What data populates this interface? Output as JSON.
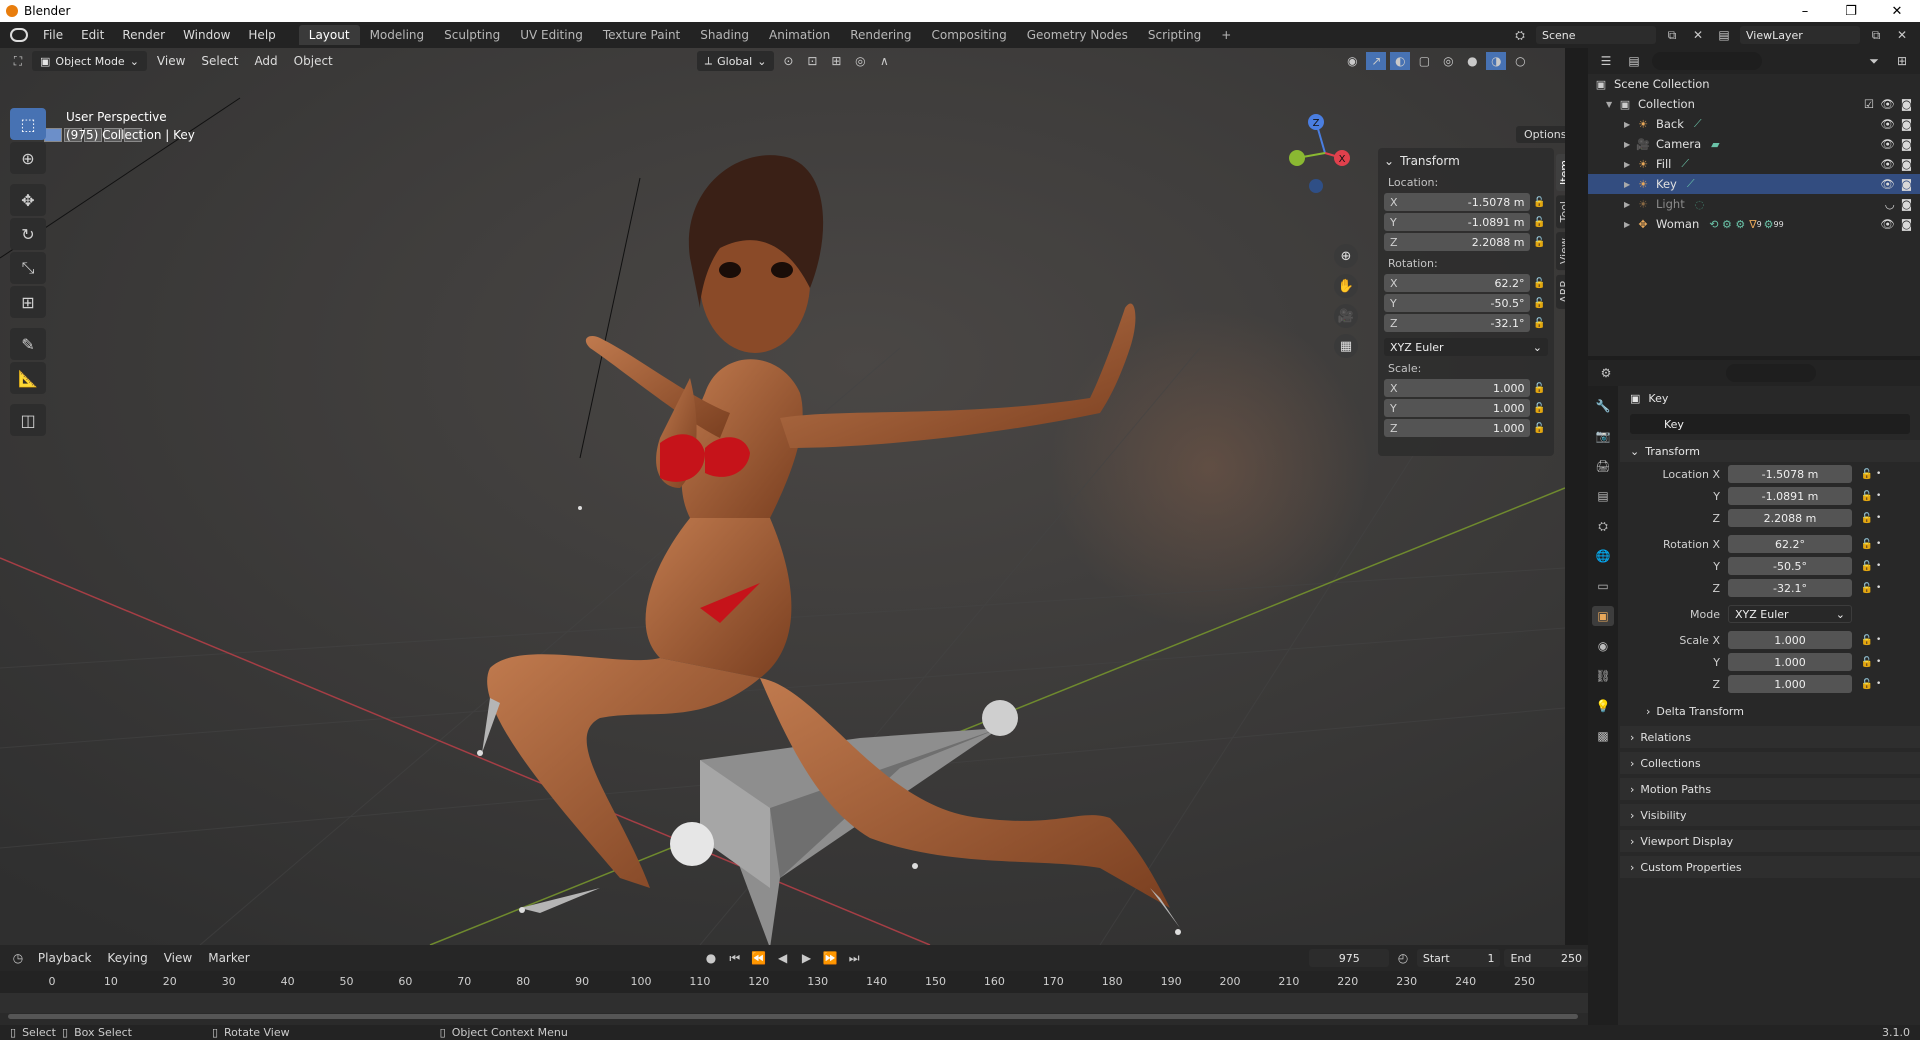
{
  "window": {
    "title": "Blender",
    "controls": [
      "–",
      "❐",
      "✕"
    ]
  },
  "menu": [
    "File",
    "Edit",
    "Render",
    "Window",
    "Help"
  ],
  "workspaces": [
    "Layout",
    "Modeling",
    "Sculpting",
    "UV Editing",
    "Texture Paint",
    "Shading",
    "Animation",
    "Rendering",
    "Compositing",
    "Geometry Nodes",
    "Scripting",
    "+"
  ],
  "active_workspace": "Layout",
  "scene": {
    "name": "Scene",
    "view_layer": "ViewLayer"
  },
  "viewport": {
    "mode": "Object Mode",
    "menus": [
      "View",
      "Select",
      "Add",
      "Object"
    ],
    "orientation": "Global",
    "options": "Options",
    "info_line1": "User Perspective",
    "info_line2": "(975) Collection | Key",
    "gizmo": {
      "x": "X",
      "y": "Y",
      "z": "Z"
    }
  },
  "npanel": {
    "section": "Transform",
    "location_label": "Location:",
    "location": [
      {
        "axis": "X",
        "value": "-1.5078 m"
      },
      {
        "axis": "Y",
        "value": "-1.0891 m"
      },
      {
        "axis": "Z",
        "value": "2.2088 m"
      }
    ],
    "rotation_label": "Rotation:",
    "rotation": [
      {
        "axis": "X",
        "value": "62.2°"
      },
      {
        "axis": "Y",
        "value": "-50.5°"
      },
      {
        "axis": "Z",
        "value": "-32.1°"
      }
    ],
    "rotation_mode": "XYZ Euler",
    "scale_label": "Scale:",
    "scale": [
      {
        "axis": "X",
        "value": "1.000"
      },
      {
        "axis": "Y",
        "value": "1.000"
      },
      {
        "axis": "Z",
        "value": "1.000"
      }
    ],
    "tabs": [
      "Item",
      "Tool",
      "View",
      "ARP"
    ]
  },
  "outliner": {
    "root": "Scene Collection",
    "collection": "Collection",
    "items": [
      {
        "name": "Back",
        "icon": "light-icon"
      },
      {
        "name": "Camera",
        "icon": "camera-icon"
      },
      {
        "name": "Fill",
        "icon": "light-icon"
      },
      {
        "name": "Key",
        "icon": "light-icon"
      },
      {
        "name": "Light",
        "icon": "light-icon"
      },
      {
        "name": "Woman",
        "icon": "armature-icon",
        "extra": "9",
        "extra2": "99"
      }
    ]
  },
  "properties": {
    "object_name": "Key",
    "name_field": "Key",
    "transform": "Transform",
    "loc_labels": [
      "Location X",
      "Y",
      "Z"
    ],
    "loc_values": [
      "-1.5078 m",
      "-1.0891 m",
      "2.2088 m"
    ],
    "rot_labels": [
      "Rotation X",
      "Y",
      "Z"
    ],
    "rot_values": [
      "62.2°",
      "-50.5°",
      "-32.1°"
    ],
    "mode_label": "Mode",
    "mode_value": "XYZ Euler",
    "scale_labels": [
      "Scale X",
      "Y",
      "Z"
    ],
    "scale_values": [
      "1.000",
      "1.000",
      "1.000"
    ],
    "delta": "Delta Transform",
    "sections": [
      "Relations",
      "Collections",
      "Motion Paths",
      "Visibility",
      "Viewport Display",
      "Custom Properties"
    ]
  },
  "timeline": {
    "menus": [
      "Playback",
      "Keying",
      "View",
      "Marker"
    ],
    "current_frame": "975",
    "start_label": "Start",
    "start": "1",
    "end_label": "End",
    "end": "250",
    "ticks": [
      "0",
      "10",
      "20",
      "30",
      "40",
      "50",
      "60",
      "70",
      "80",
      "90",
      "100",
      "110",
      "120",
      "130",
      "140",
      "150",
      "160",
      "170",
      "180",
      "190",
      "200",
      "210",
      "220",
      "230",
      "240",
      "250"
    ]
  },
  "status": {
    "select": "Select",
    "box_select": "Box Select",
    "rotate": "Rotate View",
    "context": "Object Context Menu",
    "version": "3.1.0"
  }
}
